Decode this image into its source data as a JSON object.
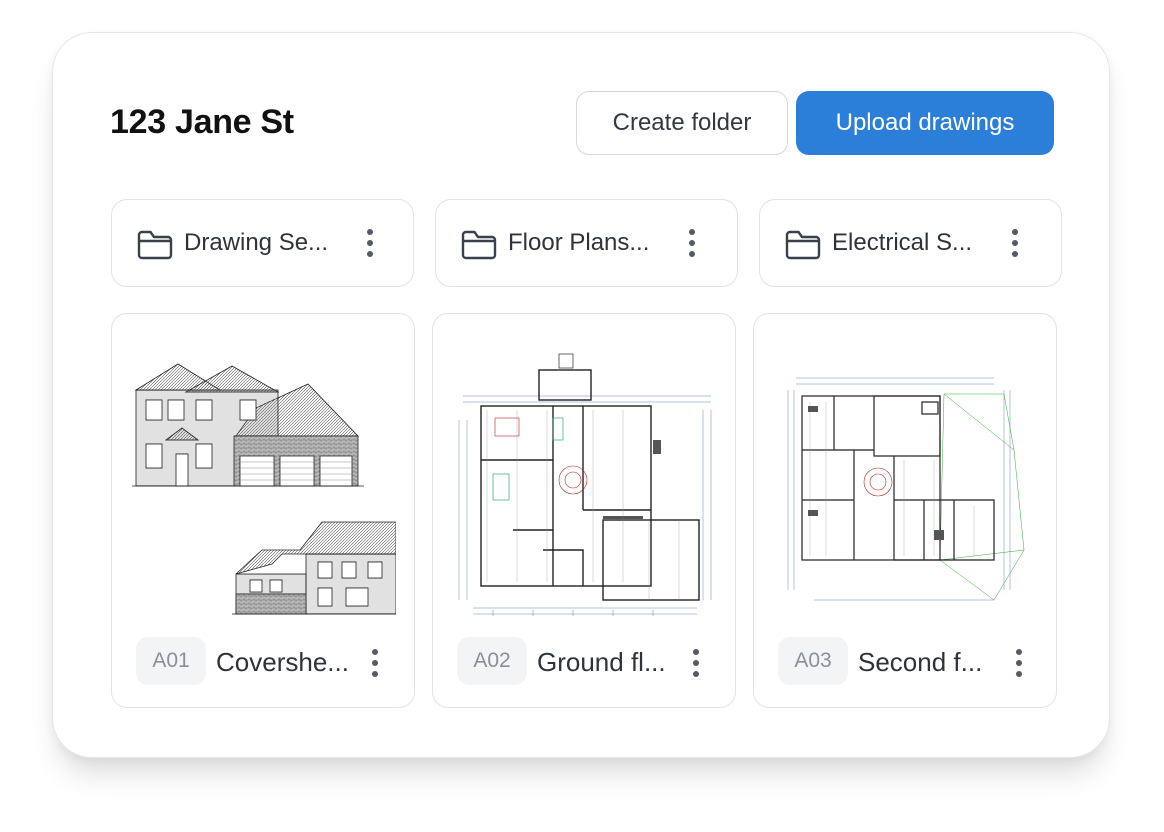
{
  "project": {
    "title": "123 Jane St"
  },
  "toolbar": {
    "create_folder_label": "Create folder",
    "upload_label": "Upload drawings"
  },
  "folders": [
    {
      "label": "Drawing Se..."
    },
    {
      "label": "Floor Plans..."
    },
    {
      "label": "Electrical S..."
    }
  ],
  "drawings": [
    {
      "code": "A01",
      "label": "Covershe..."
    },
    {
      "code": "A02",
      "label": "Ground fl..."
    },
    {
      "code": "A03",
      "label": "Second f..."
    }
  ],
  "icons": {
    "folder": "folder-icon",
    "more": "more-vertical-icon"
  },
  "colors": {
    "accent": "#2c7fd8",
    "text": "#111111",
    "border": "#e1e3e7",
    "badge_bg": "#f3f4f6"
  }
}
